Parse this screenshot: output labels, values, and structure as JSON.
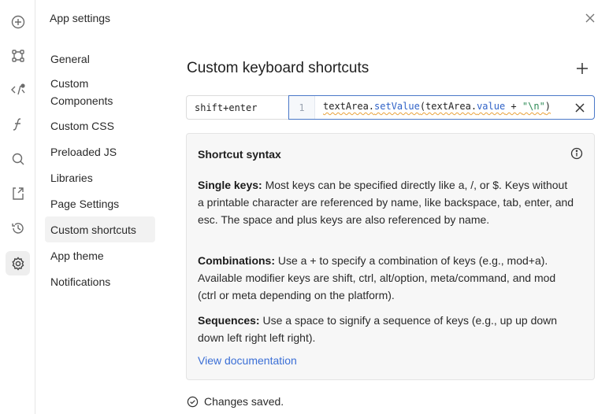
{
  "window": {
    "title": "App settings"
  },
  "nav": {
    "items": [
      {
        "label": "General"
      },
      {
        "label": "Custom Components"
      },
      {
        "label": "Custom CSS"
      },
      {
        "label": "Preloaded JS"
      },
      {
        "label": "Libraries"
      },
      {
        "label": "Page Settings"
      },
      {
        "label": "Custom shortcuts",
        "active": true
      },
      {
        "label": "App theme"
      },
      {
        "label": "Notifications"
      }
    ]
  },
  "rail": {
    "icons": [
      "plus-circle-icon",
      "components-icon",
      "code-icon",
      "function-icon",
      "search-icon",
      "import-icon",
      "history-icon",
      "gear-icon"
    ]
  },
  "main": {
    "heading": "Custom keyboard shortcuts",
    "shortcut": {
      "keys": "shift+enter",
      "line_number": "1",
      "code_tokens": [
        "textArea.",
        "setValue",
        "(textArea.",
        "value",
        " + ",
        "\"\\n\"",
        ")"
      ]
    },
    "syntax": {
      "title": "Shortcut syntax",
      "single_keys_label": "Single keys:",
      "single_keys_text": " Most keys can be specified directly like a, /, or $. Keys without a printable character are referenced by name, like backspace, tab, enter, and esc. The space and plus keys are also referenced by name.",
      "combinations_label": "Combinations:",
      "combinations_text": " Use a + to specify a combination of keys (e.g., mod+a). Available modifier keys are shift, ctrl, alt/option, meta/command, and mod (ctrl or meta depending on the platform).",
      "sequences_label": "Sequences:",
      "sequences_text": " Use a space to signify a sequence of keys (e.g., up up down down left right left right).",
      "link": "View documentation"
    },
    "status": "Changes saved."
  },
  "colors": {
    "accent": "#3b6fd6",
    "focus_border": "#4a78c8",
    "warning_underline": "#e9a23b"
  }
}
